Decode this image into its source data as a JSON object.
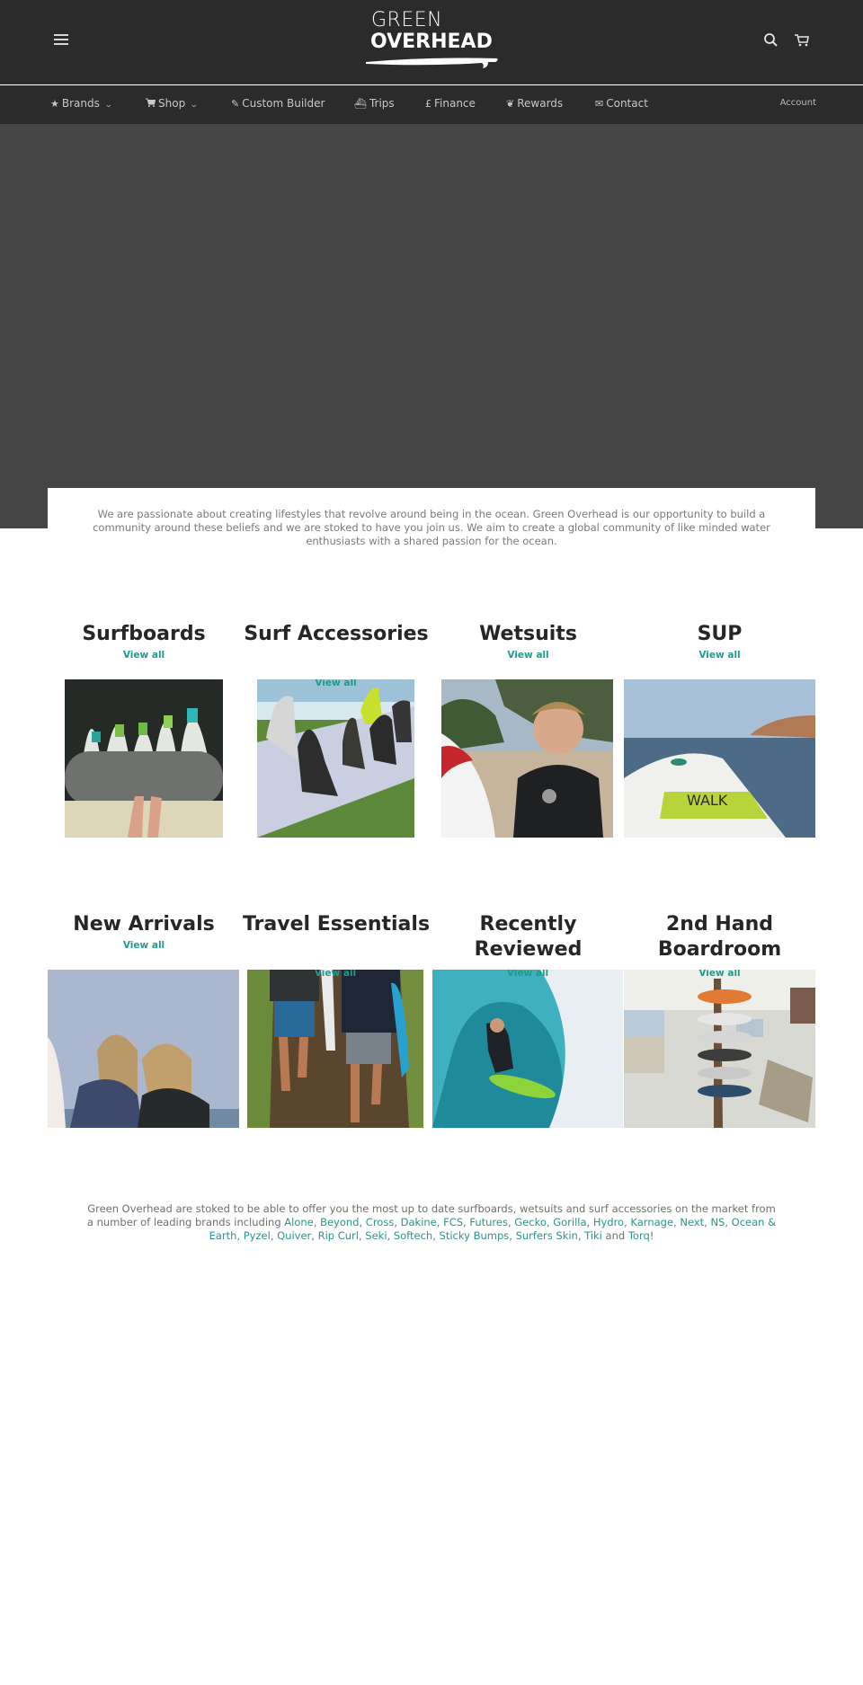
{
  "header": {
    "logo_line1": "GREEN",
    "logo_line2": "OVERHEAD",
    "menu_icon": "hamburger-menu-icon",
    "search_icon": "search-icon",
    "cart_icon": "cart-icon"
  },
  "nav": {
    "items": [
      {
        "label": "Brands",
        "icon": "star-icon",
        "glyph": "★",
        "dropdown": true
      },
      {
        "label": "Shop",
        "icon": "cart-icon",
        "glyph": "🛒",
        "dropdown": true
      },
      {
        "label": "Custom Builder",
        "icon": "pencil-icon",
        "glyph": "✎",
        "dropdown": false
      },
      {
        "label": "Trips",
        "icon": "ship-icon",
        "glyph": "⛴",
        "dropdown": false
      },
      {
        "label": "Finance",
        "icon": "pound-icon",
        "glyph": "£",
        "dropdown": false
      },
      {
        "label": "Rewards",
        "icon": "leaf-icon",
        "glyph": "❦",
        "dropdown": false
      },
      {
        "label": "Contact",
        "icon": "envelope-icon",
        "glyph": "✉",
        "dropdown": false
      }
    ],
    "account_label": "Account",
    "dropdown_glyph": "⌄"
  },
  "intro": {
    "text": "We are passionate about creating lifestyles that revolve around being in the ocean. Green Overhead is our opportunity to build a community around these beliefs and we are stoked to have you join us. We aim to create a global community of like minded water enthusiasts with a shared passion for the ocean."
  },
  "collections": [
    {
      "title": "Surfboards",
      "link": "View all",
      "image": "surfboards-rack-photo"
    },
    {
      "title": "Surf Accessories",
      "link": "View all",
      "image": "surf-fins-photo"
    },
    {
      "title": "Wetsuits",
      "link": "View all",
      "image": "surfer-wetsuit-photo"
    },
    {
      "title": "SUP",
      "link": "View all",
      "image": "sup-board-photo"
    },
    {
      "title": "New Arrivals",
      "link": "View all",
      "image": "two-surfers-photo"
    },
    {
      "title": "Travel Essentials",
      "link": "View all",
      "image": "surfers-walking-path-photo"
    },
    {
      "title": "Recently Reviewed",
      "link": "View all",
      "image": "barrel-wave-surfer-photo"
    },
    {
      "title": "2nd Hand Boardroom",
      "link": "View all",
      "image": "boat-board-rack-photo"
    }
  ],
  "brands_section": {
    "intro": "Green Overhead are stoked to be able to offer you the most up to date surfboards, wetsuits and surf accessories on the market from a number of leading brands including ",
    "brands": [
      "Alone",
      "Beyond",
      "Cross",
      "Dakine",
      "FCS",
      "Futures",
      "Gecko",
      "Gorilla",
      "Hydro",
      "Karnage",
      "Next",
      "NS",
      "Ocean & Earth",
      "Pyzel",
      "Quiver",
      "Rip Curl",
      "Seki",
      "Softech",
      "Sticky Bumps",
      "Surfers Skin",
      "Tiki"
    ],
    "conjunction": " and ",
    "last_brand": "Torq",
    "ending": "!"
  },
  "colors": {
    "header_bg": "#2b2b2b",
    "hero_bg": "#454545",
    "accent": "#1f9b8d",
    "heading": "#262626"
  }
}
